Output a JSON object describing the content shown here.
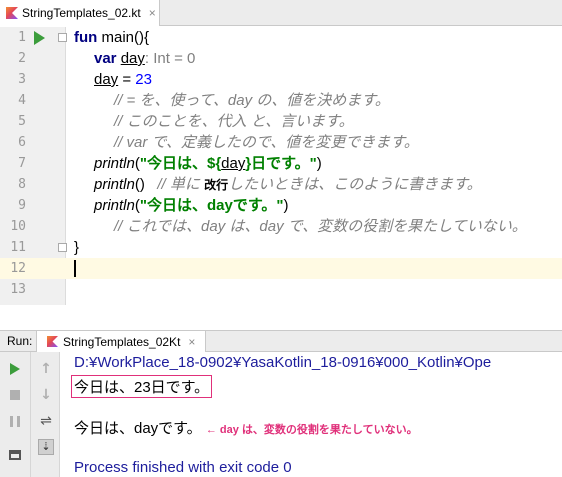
{
  "editor_tab": {
    "filename": "StringTemplates_02.kt",
    "close": "×"
  },
  "lines": {
    "n": [
      "1",
      "2",
      "3",
      "4",
      "5",
      "6",
      "7",
      "8",
      "9",
      "10",
      "11",
      "12",
      "13"
    ],
    "l1": {
      "kw": "fun",
      "rest": " main(){"
    },
    "l2": {
      "kw": "var",
      "var": "day",
      "type": ": Int = 0"
    },
    "l3": {
      "var": "day",
      "eq": " = ",
      "num": "23"
    },
    "l4": "// = を、使って、day の、値を決めます。",
    "l5": "// このことを、代入 と、言います。",
    "l6": "// var で、定義したので、値を変更できます。",
    "l7": {
      "fn": "println",
      "open": "(",
      "s1": "\"今日は、${",
      "var": "day",
      "s2": "}日です。\"",
      "close": ")"
    },
    "l8": {
      "fn": "println",
      "parens": "()",
      "cmt1": "// 単に",
      "bold": "改行",
      "cmt2": "したいときは、このように書きます。"
    },
    "l9": {
      "fn": "println",
      "open": "(",
      "str": "\"今日は、dayです。\"",
      "close": ")"
    },
    "l10": "// これでは、day は、day で、変数の役割を果たしていない。",
    "l11": "}"
  },
  "run": {
    "label": "Run:",
    "tab": "StringTemplates_02Kt",
    "close": "×",
    "console": {
      "path": "D:¥WorkPlace_18-0902¥YasaKotlin_18-0916¥000_Kotlin¥Ope",
      "out1": "今日は、23日です。",
      "out2": "今日は、dayです。",
      "note": "← day は、変数の役割を果たしていない。",
      "finish": "Process finished with exit code 0"
    }
  },
  "colors": {
    "keyword": "#000080",
    "string": "#008000",
    "number": "#0000ff",
    "comment": "#808080",
    "highlight": "#e0307a"
  }
}
